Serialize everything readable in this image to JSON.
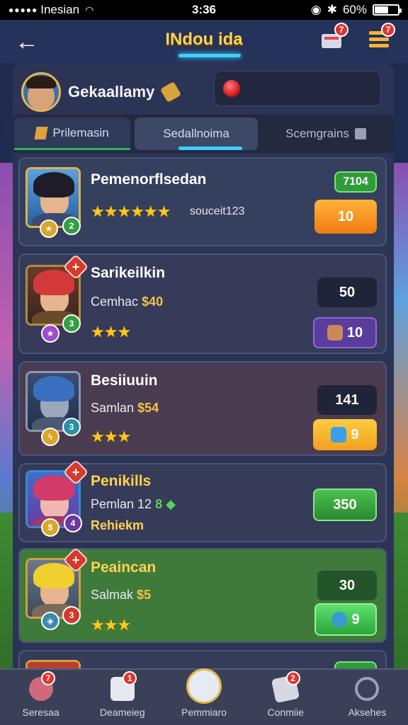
{
  "status_bar": {
    "signal": "●●●●●",
    "carrier": "Inesian",
    "time": "3:36",
    "battery_text": "60%",
    "battery_level": 0.6
  },
  "header": {
    "title": "INdou ida",
    "mail_badge": "7",
    "menu_badge": "7",
    "back_glyph": "←"
  },
  "profile": {
    "name": "Gekaallamy",
    "search_placeholder": ""
  },
  "tabs": [
    {
      "label": "Prilemasin"
    },
    {
      "label": "Sedallnoima"
    },
    {
      "label": "Scemgrains"
    }
  ],
  "cards": [
    {
      "name": "Pemenorflsedan",
      "stars": "★★★★★★",
      "subtext": "souceit123",
      "tag": "7104",
      "value": "10",
      "level": "2"
    },
    {
      "name": "Sarikeilkin",
      "sub_label": "Cemhac",
      "sub_value": "$40",
      "stars": "★★★",
      "value": "50",
      "action_value": "10",
      "level": "3"
    },
    {
      "name": "Besiiuuin",
      "sub_label": "Samlan",
      "sub_value": "$54",
      "stars": "★★★",
      "value": "141",
      "action_value": "9",
      "level": "3"
    },
    {
      "name": "Penikills",
      "sub_label": "Pemlan 12",
      "sub_value": "8",
      "extra": "Rehiekm",
      "action_value": "350",
      "level": "4"
    },
    {
      "name": "Peaincan",
      "sub_label": "Salmak",
      "sub_value": "$5",
      "stars": "★★★",
      "value": "30",
      "action_value": "9",
      "level": "3"
    }
  ],
  "nav": [
    {
      "label": "Seresaa",
      "badge": "7"
    },
    {
      "label": "Deameieg",
      "badge": "1"
    },
    {
      "label": "Pemmiaro",
      "badge": ""
    },
    {
      "label": "Conmiie",
      "badge": "2"
    },
    {
      "label": "Aksehes",
      "badge": ""
    }
  ],
  "colors": {
    "accent_gold": "#ffd34e",
    "accent_cyan": "#3ed0ff",
    "orange_button": "#f6941e",
    "purple_button": "#5a3c9c",
    "green_button": "#33a23a",
    "yellow_button": "#f2b52b"
  }
}
